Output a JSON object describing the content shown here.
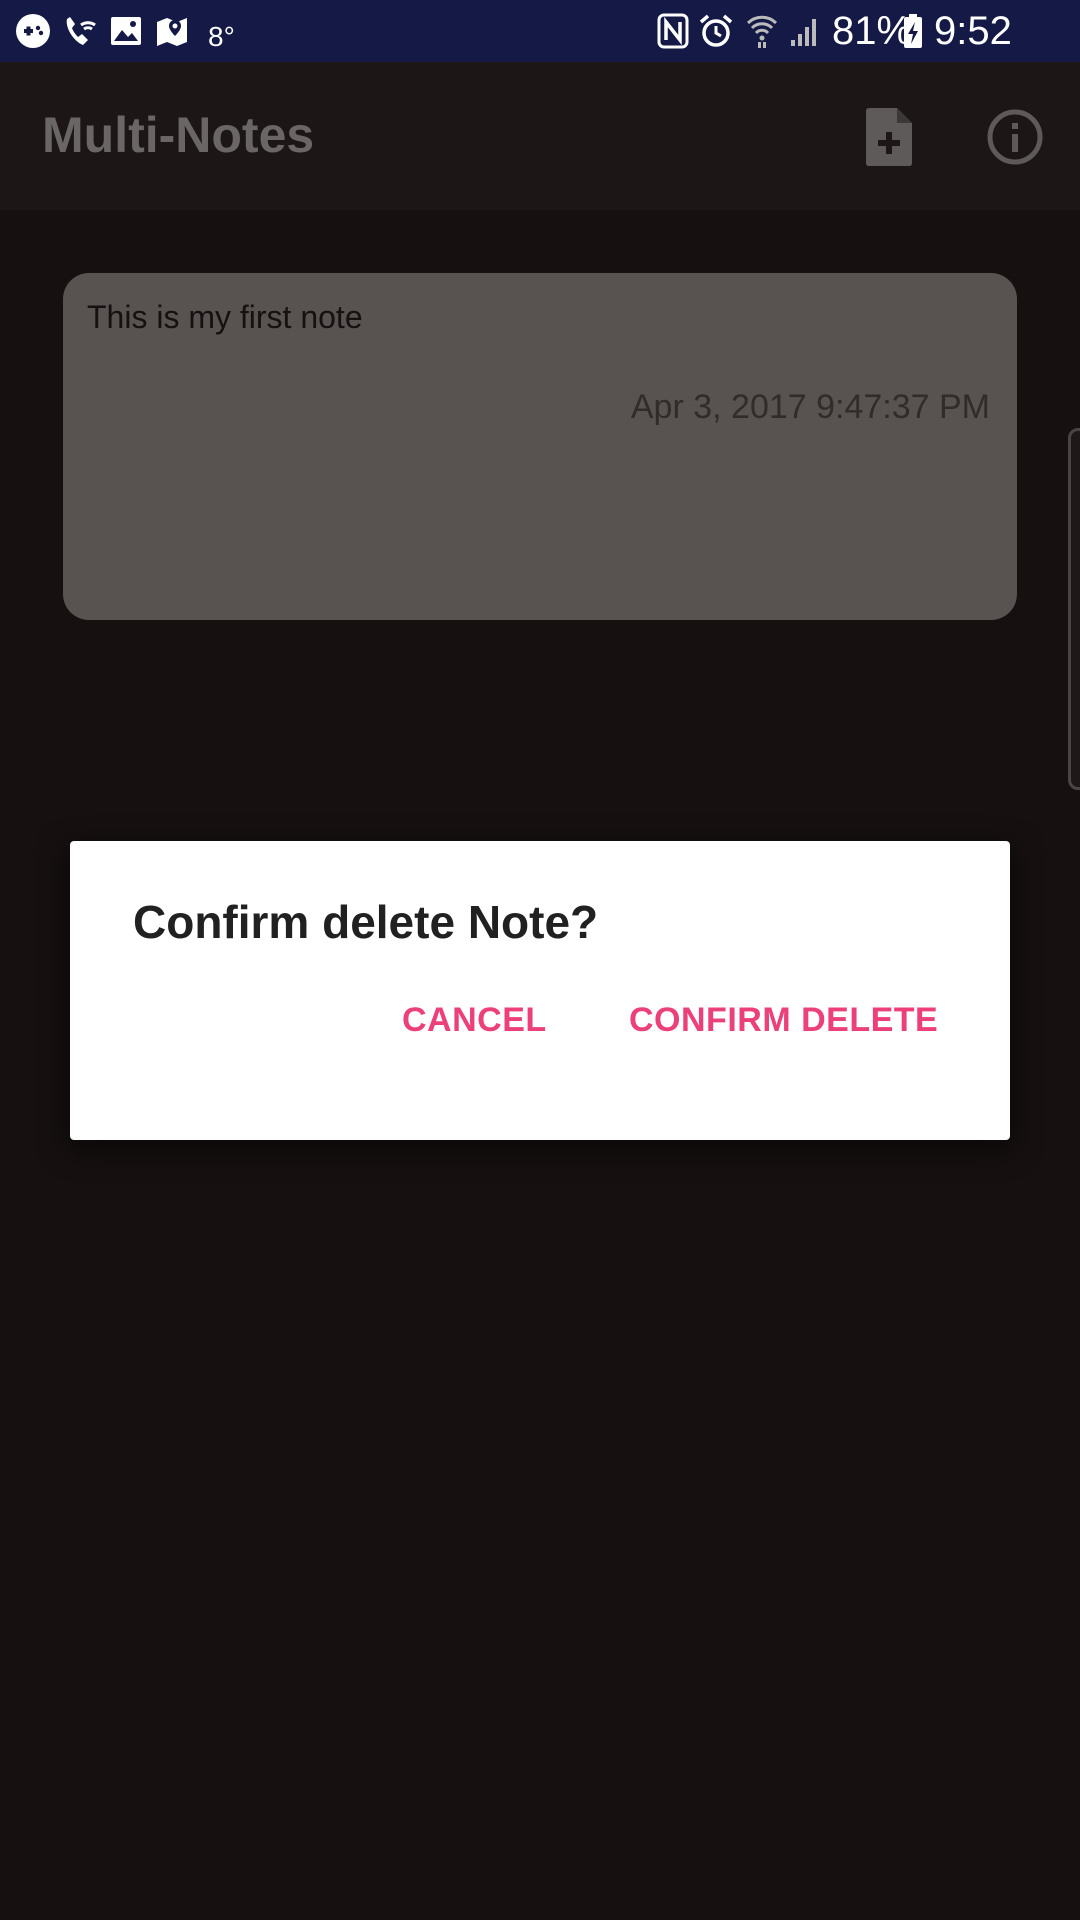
{
  "status_bar": {
    "left_icons": [
      "game-controller-icon",
      "wifi-calling-icon",
      "gallery-icon",
      "maps-icon"
    ],
    "temperature": "8°",
    "right_icons": [
      "nfc-icon",
      "alarm-icon",
      "wifi-icon",
      "signal-icon",
      "battery-charging-icon"
    ],
    "battery": "81%",
    "time": "9:52 PM"
  },
  "app_bar": {
    "title": "Multi-Notes",
    "actions": [
      "new-note-icon",
      "info-icon"
    ]
  },
  "notes": [
    {
      "title": "This is my first note",
      "timestamp": "Apr 3, 2017 9:47:37 PM"
    }
  ],
  "dialog": {
    "title": "Confirm delete Note?",
    "cancel_label": "CANCEL",
    "confirm_label": "CONFIRM DELETE"
  },
  "colors": {
    "status_bar": "#141a45",
    "accent": "#ec407a",
    "background": "#161010",
    "card": "#585351"
  }
}
